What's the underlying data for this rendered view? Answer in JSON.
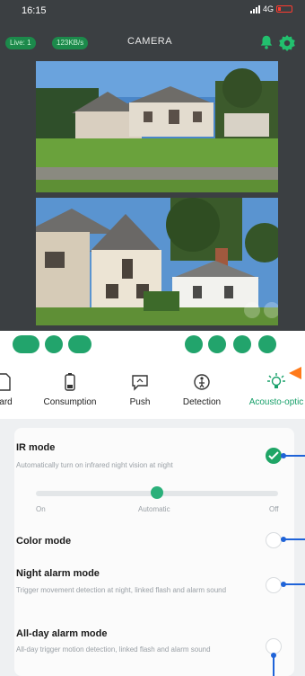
{
  "status_bar": {
    "time": "16:15",
    "network": "4G"
  },
  "camera": {
    "live_label": "Live: 1",
    "speed": "123KB/s",
    "title": "CAMERA"
  },
  "tabs": [
    {
      "label": "card",
      "icon": "sd-card-icon",
      "active": false
    },
    {
      "label": "Consumption",
      "icon": "battery-icon",
      "active": false
    },
    {
      "label": "Push",
      "icon": "message-icon",
      "active": false
    },
    {
      "label": "Detection",
      "icon": "detection-icon",
      "active": false
    },
    {
      "label": "Acousto-optic",
      "icon": "light-bulb-icon",
      "active": true
    }
  ],
  "settings": {
    "ir_mode": {
      "title": "IR mode",
      "desc": "Automatically turn on infrared night vision at night",
      "enabled": true,
      "slider_options": [
        "On",
        "Automatic",
        "Off"
      ],
      "slider_selected": "Automatic"
    },
    "color_mode": {
      "title": "Color mode",
      "enabled": false
    },
    "night_alarm": {
      "title": "Night alarm mode",
      "desc": "Trigger movement detection at night, linked flash and alarm sound",
      "enabled": false
    },
    "allday_alarm": {
      "title": "All-day alarm mode",
      "desc": "All-day trigger motion detection, linked flash and alarm sound",
      "enabled": false
    }
  },
  "colors": {
    "accent": "#1fa566",
    "arrow": "#ff7a1a",
    "callout": "#1f63d8",
    "dark": "#3b3f42"
  }
}
